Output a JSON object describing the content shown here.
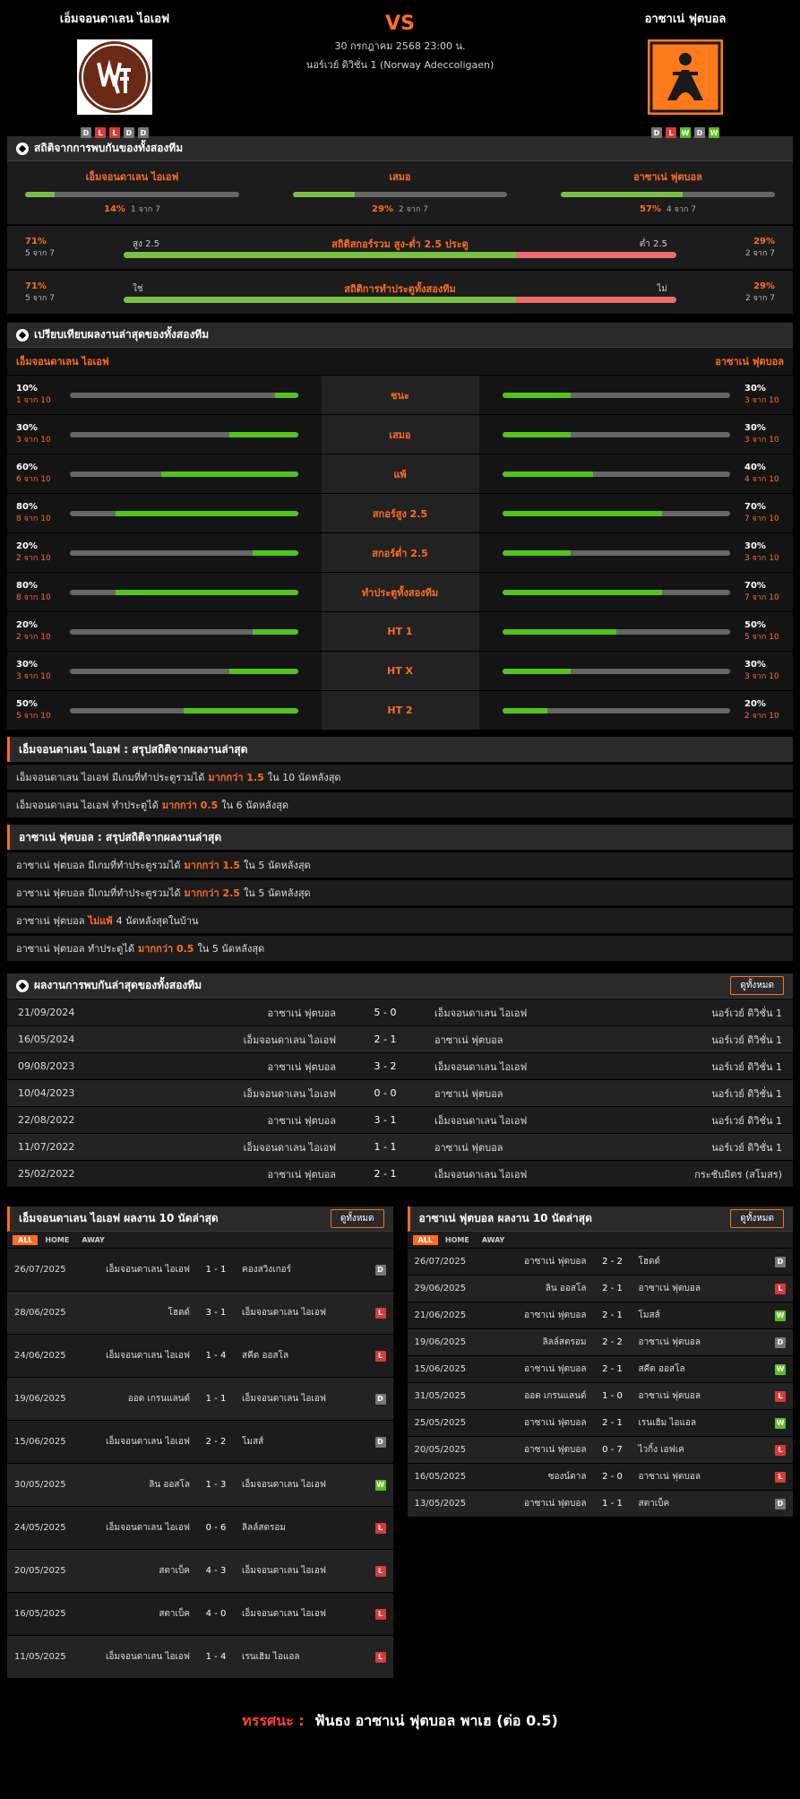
{
  "header": {
    "home_name": "เอ็มจอนดาเลน ไอเอฟ",
    "away_name": "อาซาเน่ ฟุตบอล",
    "vs": "VS",
    "date": "30 กรกฎาคม 2568 23:00 น.",
    "league": "นอร์เวย์ ดิวิชั่น 1 (Norway Adeccoligaen)",
    "home_form": [
      "D",
      "L",
      "L",
      "D",
      "D"
    ],
    "away_form": [
      "D",
      "L",
      "W",
      "D",
      "W"
    ]
  },
  "h2h_stats": {
    "title": "สถิติจากการพบกันของทั้งสองทีม",
    "items": [
      {
        "label": "เอ็มจอนดาเลน ไอเอฟ",
        "pct": "14%",
        "of": "1 จาก 7",
        "fill": 14
      },
      {
        "label": "เสมอ",
        "pct": "29%",
        "of": "2 จาก 7",
        "fill": 29
      },
      {
        "label": "อาซาเน่ ฟุตบอล",
        "pct": "57%",
        "of": "4 จาก 7",
        "fill": 57
      }
    ],
    "ou": {
      "title": "สถิติสกอร์รวม สูง-ต่ำ 2.5 ประตู",
      "left_pct": "71%",
      "left_of": "5 จาก 7",
      "left_label": "สูง 2.5",
      "right_label": "ต่ำ 2.5",
      "right_pct": "29%",
      "right_of": "2 จาก 7",
      "fill": 71
    },
    "btts": {
      "title": "สถิติการทำประตูทั้งสองทีม",
      "left_pct": "71%",
      "left_of": "5 จาก 7",
      "left_label": "ใช่",
      "right_label": "ไม่",
      "right_pct": "29%",
      "right_of": "2 จาก 7",
      "fill": 71
    }
  },
  "compare": {
    "title": "เปรียบเทียบผลงานล่าสุดของทั้งสองทีม",
    "home": "เอ็มจอนดาเลน ไอเอฟ",
    "away": "อาซาเน่ ฟุตบอล",
    "rows": [
      {
        "label": "ชนะ",
        "h": "10%",
        "hof": "1 จาก 10",
        "hv": 10,
        "a": "30%",
        "aof": "3 จาก 10",
        "av": 30
      },
      {
        "label": "เสมอ",
        "h": "30%",
        "hof": "3 จาก 10",
        "hv": 30,
        "a": "30%",
        "aof": "3 จาก 10",
        "av": 30
      },
      {
        "label": "แพ้",
        "h": "60%",
        "hof": "6 จาก 10",
        "hv": 60,
        "a": "40%",
        "aof": "4 จาก 10",
        "av": 40
      },
      {
        "label": "สกอร์สูง 2.5",
        "h": "80%",
        "hof": "8 จาก 10",
        "hv": 80,
        "a": "70%",
        "aof": "7 จาก 10",
        "av": 70
      },
      {
        "label": "สกอร์ต่ำ 2.5",
        "h": "20%",
        "hof": "2 จาก 10",
        "hv": 20,
        "a": "30%",
        "aof": "3 จาก 10",
        "av": 30
      },
      {
        "label": "ทำประตูทั้งสองทีม",
        "h": "80%",
        "hof": "8 จาก 10",
        "hv": 80,
        "a": "70%",
        "aof": "7 จาก 10",
        "av": 70
      },
      {
        "label": "HT 1",
        "h": "20%",
        "hof": "2 จาก 10",
        "hv": 20,
        "a": "50%",
        "aof": "5 จาก 10",
        "av": 50
      },
      {
        "label": "HT X",
        "h": "30%",
        "hof": "3 จาก 10",
        "hv": 30,
        "a": "30%",
        "aof": "3 จาก 10",
        "av": 30
      },
      {
        "label": "HT 2",
        "h": "50%",
        "hof": "5 จาก 10",
        "hv": 50,
        "a": "20%",
        "aof": "2 จาก 10",
        "av": 20
      }
    ]
  },
  "home_summary": {
    "title": "เอ็มจอนดาเลน ไอเอฟ : สรุปสถิติจากผลงานล่าสุด",
    "lines": [
      {
        "pre": "เอ็มจอนดาเลน ไอเอฟ  มีเกมที่ทำประตูรวมได้",
        "hl": "มากกว่า 1.5",
        "post": "ใน 10 นัดหลังสุด"
      },
      {
        "pre": "เอ็มจอนดาเลน ไอเอฟ  ทำประตูได้",
        "hl": "มากกว่า 0.5",
        "post": "ใน 6 นัดหลังสุด"
      }
    ]
  },
  "away_summary": {
    "title": "อาซาเน่ ฟุตบอล : สรุปสถิติจากผลงานล่าสุด",
    "lines": [
      {
        "pre": "อาซาเน่ ฟุตบอล  มีเกมที่ทำประตูรวมได้",
        "hl": "มากกว่า 1.5",
        "post": "ใน 5 นัดหลังสุด"
      },
      {
        "pre": "อาซาเน่ ฟุตบอล  มีเกมที่ทำประตูรวมได้",
        "hl": "มากกว่า 2.5",
        "post": "ใน 5 นัดหลังสุด"
      },
      {
        "pre": "อาซาเน่ ฟุตบอล",
        "hl": "ไม่แพ้",
        "post": "4  นัดหลังสุดในบ้าน"
      },
      {
        "pre": "อาซาเน่ ฟุตบอล  ทำประตูได้",
        "hl": "มากกว่า 0.5",
        "post": "ใน 5 นัดหลังสุด"
      }
    ]
  },
  "h2h_results": {
    "title": "ผลงานการพบกันล่าสุดของทั้งสองทีม",
    "view_all": "ดูทั้งหมด",
    "rows": [
      {
        "date": "21/09/2024",
        "home": "อาซาเน่ ฟุตบอล",
        "score": "5 - 0",
        "away": "เอ็มจอนดาเลน ไอเอฟ",
        "comp": "นอร์เวย์ ดิวิชั่น 1"
      },
      {
        "date": "16/05/2024",
        "home": "เอ็มจอนดาเลน ไอเอฟ",
        "score": "2 - 1",
        "away": "อาซาเน่ ฟุตบอล",
        "comp": "นอร์เวย์ ดิวิชั่น 1"
      },
      {
        "date": "09/08/2023",
        "home": "อาซาเน่ ฟุตบอล",
        "score": "3 - 2",
        "away": "เอ็มจอนดาเลน ไอเอฟ",
        "comp": "นอร์เวย์ ดิวิชั่น 1"
      },
      {
        "date": "10/04/2023",
        "home": "เอ็มจอนดาเลน ไอเอฟ",
        "score": "0 - 0",
        "away": "อาซาเน่ ฟุตบอล",
        "comp": "นอร์เวย์ ดิวิชั่น 1"
      },
      {
        "date": "22/08/2022",
        "home": "อาซาเน่ ฟุตบอล",
        "score": "3 - 1",
        "away": "เอ็มจอนดาเลน ไอเอฟ",
        "comp": "นอร์เวย์ ดิวิชั่น 1"
      },
      {
        "date": "11/07/2022",
        "home": "เอ็มจอนดาเลน ไอเอฟ",
        "score": "1 - 1",
        "away": "อาซาเน่ ฟุตบอล",
        "comp": "นอร์เวย์ ดิวิชั่น 1"
      },
      {
        "date": "25/02/2022",
        "home": "อาซาเน่ ฟุตบอล",
        "score": "2 - 1",
        "away": "เอ็มจอนดาเลน ไอเอฟ",
        "comp": "กระชับมิตร (สโมสร)"
      }
    ]
  },
  "home_last10": {
    "title": "เอ็มจอนดาเลน ไอเอฟ ผลงาน 10 นัดล่าสุด",
    "view_all": "ดูทั้งหมด",
    "tabs": [
      "ALL",
      "HOME",
      "AWAY"
    ],
    "rows": [
      {
        "date": "26/07/2025",
        "home": "เอ็มจอนดาเลน ไอเอฟ",
        "score": "1 - 1",
        "away": "คองสวิงเกอร์",
        "res": "D"
      },
      {
        "date": "28/06/2025",
        "home": "โฮดด์",
        "score": "3 - 1",
        "away": "เอ็มจอนดาเลน ไอเอฟ",
        "res": "L"
      },
      {
        "date": "24/06/2025",
        "home": "เอ็มจอนดาเลน ไอเอฟ",
        "score": "1 - 4",
        "away": "สคีด ออสโล",
        "res": "L"
      },
      {
        "date": "19/06/2025",
        "home": "ออด เกรนแลนด์",
        "score": "1 - 1",
        "away": "เอ็มจอนดาเลน ไอเอฟ",
        "res": "D"
      },
      {
        "date": "15/06/2025",
        "home": "เอ็มจอนดาเลน ไอเอฟ",
        "score": "2 - 2",
        "away": "โมสส์",
        "res": "D"
      },
      {
        "date": "30/05/2025",
        "home": "ลิน ออสโล",
        "score": "1 - 3",
        "away": "เอ็มจอนดาเลน ไอเอฟ",
        "res": "W"
      },
      {
        "date": "24/05/2025",
        "home": "เอ็มจอนดาเลน ไอเอฟ",
        "score": "0 - 6",
        "away": "ลิลล์สตรอม",
        "res": "L"
      },
      {
        "date": "20/05/2025",
        "home": "สตาเบ็ค",
        "score": "4 - 3",
        "away": "เอ็มจอนดาเลน ไอเอฟ",
        "res": "L"
      },
      {
        "date": "16/05/2025",
        "home": "สตาเบ็ค",
        "score": "4 - 0",
        "away": "เอ็มจอนดาเลน ไอเอฟ",
        "res": "L"
      },
      {
        "date": "11/05/2025",
        "home": "เอ็มจอนดาเลน ไอเอฟ",
        "score": "1 - 4",
        "away": "เรนเฮิม ไอแอล",
        "res": "L"
      }
    ]
  },
  "away_last10": {
    "title": "อาซาเน่ ฟุตบอล ผลงาน 10 นัดล่าสุด",
    "view_all": "ดูทั้งหมด",
    "tabs": [
      "ALL",
      "HOME",
      "AWAY"
    ],
    "rows": [
      {
        "date": "26/07/2025",
        "home": "อาซาเน่ ฟุตบอล",
        "score": "2 - 2",
        "away": "โฮดด์",
        "res": "D"
      },
      {
        "date": "29/06/2025",
        "home": "ลิน ออสโล",
        "score": "2 - 1",
        "away": "อาซาเน่ ฟุตบอล",
        "res": "L"
      },
      {
        "date": "21/06/2025",
        "home": "อาซาเน่ ฟุตบอล",
        "score": "2 - 1",
        "away": "โมสส์",
        "res": "W"
      },
      {
        "date": "19/06/2025",
        "home": "ลิลล์สตรอม",
        "score": "2 - 2",
        "away": "อาซาเน่ ฟุตบอล",
        "res": "D"
      },
      {
        "date": "15/06/2025",
        "home": "อาซาเน่ ฟุตบอล",
        "score": "2 - 1",
        "away": "สคีด ออสโล",
        "res": "W"
      },
      {
        "date": "31/05/2025",
        "home": "ออด เกรนแลนด์",
        "score": "1 - 0",
        "away": "อาซาเน่ ฟุตบอล",
        "res": "L"
      },
      {
        "date": "25/05/2025",
        "home": "อาซาเน่ ฟุตบอล",
        "score": "2 - 1",
        "away": "เรนเฮิม ไอแอล",
        "res": "W"
      },
      {
        "date": "20/05/2025",
        "home": "อาซาเน่ ฟุตบอล",
        "score": "0 - 7",
        "away": "ไวกิ้ง เอฟเค",
        "res": "L"
      },
      {
        "date": "16/05/2025",
        "home": "ซองน์ดาล",
        "score": "2 - 0",
        "away": "อาซาเน่ ฟุตบอล",
        "res": "L"
      },
      {
        "date": "13/05/2025",
        "home": "อาซาเน่ ฟุตบอล",
        "score": "1 - 1",
        "away": "สตาเบ็ค",
        "res": "D"
      }
    ]
  },
  "footer": {
    "label": "ทรรศนะ :",
    "text": "ฟันธง อาซาเน่ ฟุตบอล พาเฮ (ต่อ 0.5)"
  },
  "colors": {
    "accent": "#ff6e21",
    "win": "#5bbf1d",
    "loss": "#d93a3a",
    "draw": "#777777",
    "bar_green": "#77c043",
    "bar_red": "#ee6b6e"
  },
  "icons": {
    "section": "soccer-ball-icon",
    "home_logo": "mjondalen-crest-logo",
    "away_logo": "asane-crest-logo"
  }
}
